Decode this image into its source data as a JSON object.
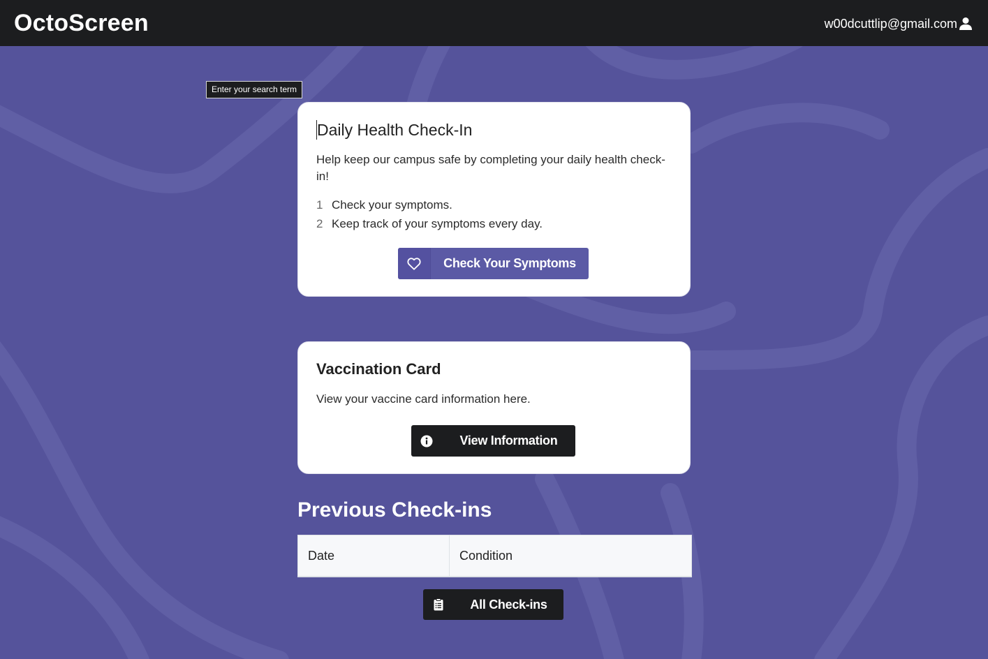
{
  "app": {
    "brand": "OctoScreen"
  },
  "user": {
    "email": "w00dcuttlip@gmail.com",
    "icon": "user-icon"
  },
  "search": {
    "tooltip": "Enter your search term"
  },
  "checkin_card": {
    "title": "Daily Health Check-In",
    "description": "Help keep our campus safe by completing your daily health check-in!",
    "steps": [
      {
        "number": "1",
        "text": "Check your symptoms."
      },
      {
        "number": "2",
        "text": "Keep track of your symptoms every day."
      }
    ],
    "button": {
      "label": "Check Your Symptoms",
      "icon": "heart-icon"
    }
  },
  "vaccine_card": {
    "title": "Vaccination Card",
    "description": "View your vaccine card information here.",
    "button": {
      "label": "View Information",
      "icon": "info-circle-icon"
    }
  },
  "previous_checkins": {
    "title": "Previous Check-ins",
    "columns": [
      "Date",
      "Condition"
    ],
    "rows": [],
    "button": {
      "label": "All Check-ins",
      "icon": "clipboard-list-icon"
    }
  },
  "colors": {
    "background": "#55539b",
    "topbar": "#1c1d1f",
    "primary_button": "#5b5aa5",
    "dark_button": "#1c1d1f"
  }
}
